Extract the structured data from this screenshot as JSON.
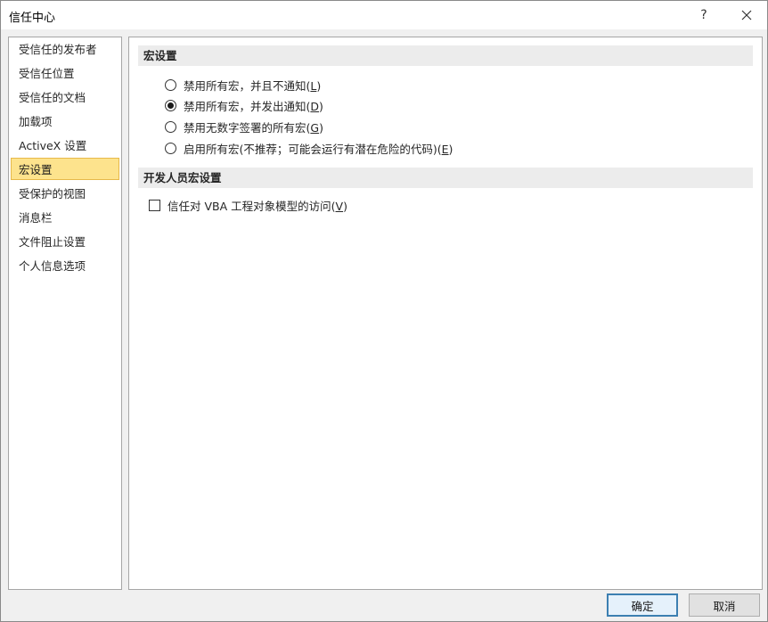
{
  "window": {
    "title": "信任中心",
    "help_label": "?"
  },
  "sidebar": {
    "items": [
      {
        "label": "受信任的发布者"
      },
      {
        "label": "受信任位置"
      },
      {
        "label": "受信任的文档"
      },
      {
        "label": "加载项"
      },
      {
        "label": "ActiveX 设置"
      },
      {
        "label": "宏设置",
        "active": true
      },
      {
        "label": "受保护的视图"
      },
      {
        "label": "消息栏"
      },
      {
        "label": "文件阻止设置"
      },
      {
        "label": "个人信息选项"
      }
    ]
  },
  "macro_settings": {
    "header": "宏设置",
    "options": [
      {
        "text": "禁用所有宏，并且不通知(",
        "key": "L",
        "close": ")",
        "checked": false
      },
      {
        "text": "禁用所有宏，并发出通知(",
        "key": "D",
        "close": ")",
        "checked": true
      },
      {
        "text": "禁用无数字签署的所有宏(",
        "key": "G",
        "close": ")",
        "checked": false
      },
      {
        "text": "启用所有宏(不推荐；可能会运行有潜在危险的代码)(",
        "key": "E",
        "close": ")",
        "checked": false
      }
    ]
  },
  "developer_settings": {
    "header": "开发人员宏设置",
    "checkbox": {
      "text": "信任对 VBA 工程对象模型的访问(",
      "key": "V",
      "close": ")",
      "checked": false
    }
  },
  "buttons": {
    "ok": "确定",
    "cancel": "取消"
  }
}
